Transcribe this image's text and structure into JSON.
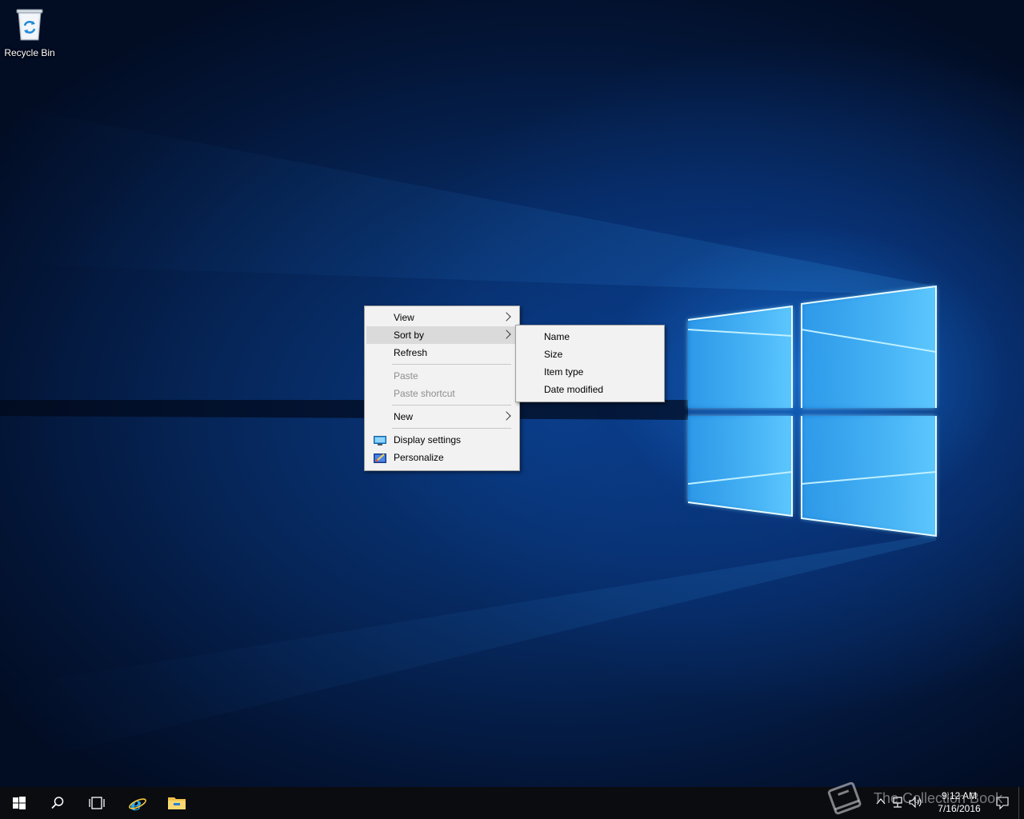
{
  "desktop": {
    "icons": [
      {
        "label": "Recycle Bin",
        "icon": "recycle-bin-icon"
      }
    ]
  },
  "context_menu": {
    "items": [
      {
        "label": "View",
        "has_submenu": true
      },
      {
        "label": "Sort by",
        "has_submenu": true,
        "highlighted": true
      },
      {
        "label": "Refresh"
      },
      {
        "label": "Paste",
        "disabled": true
      },
      {
        "label": "Paste shortcut",
        "disabled": true
      },
      {
        "label": "New",
        "has_submenu": true
      },
      {
        "label": "Display settings",
        "icon": "display-settings-icon"
      },
      {
        "label": "Personalize",
        "icon": "personalize-icon"
      }
    ]
  },
  "sort_submenu": {
    "items": [
      {
        "label": "Name"
      },
      {
        "label": "Size"
      },
      {
        "label": "Item type"
      },
      {
        "label": "Date modified"
      }
    ]
  },
  "taskbar": {
    "buttons": [
      "start-icon",
      "search-icon",
      "task-view-icon",
      "internet-explorer-icon",
      "file-explorer-icon"
    ],
    "tray": {
      "time": "9:12 AM",
      "date": "7/16/2016"
    }
  },
  "watermark": {
    "text": "The Collection Book"
  },
  "colors": {
    "taskbar": "#0a0c10",
    "menu_bg": "#f2f2f2",
    "menu_highlight": "#dadada",
    "wallpaper_glow": "#4cc2ff"
  }
}
